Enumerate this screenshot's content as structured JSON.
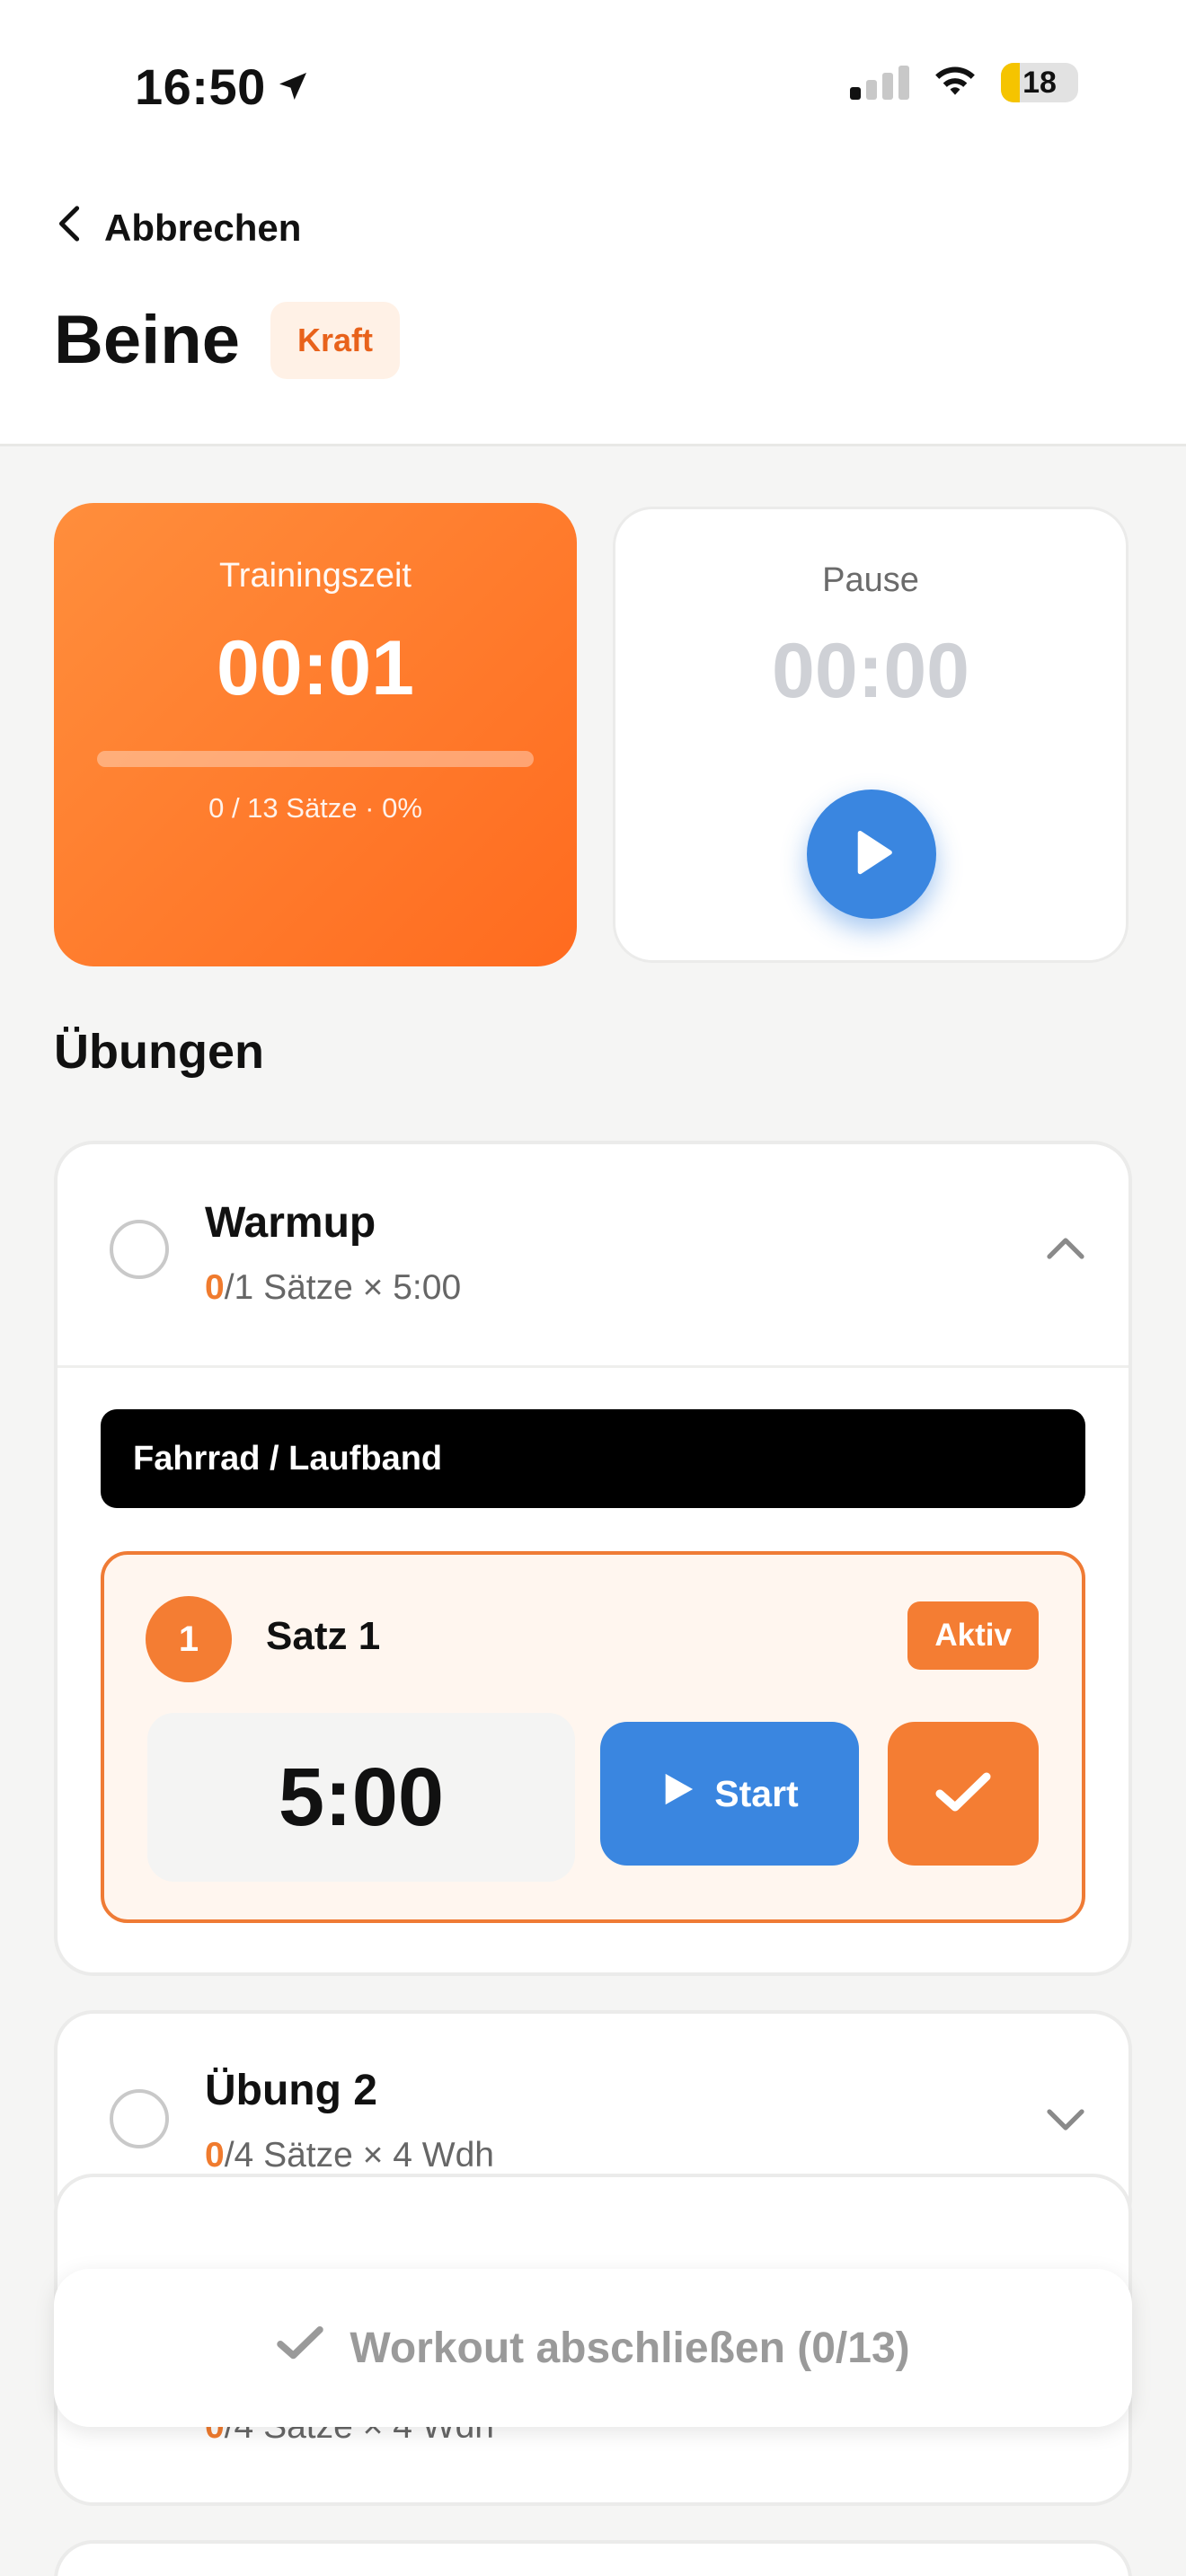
{
  "status_bar": {
    "time": "16:50",
    "battery_level": "18"
  },
  "header": {
    "back_label": "Abbrechen",
    "title": "Beine",
    "tag": "Kraft"
  },
  "training_card": {
    "label": "Trainingszeit",
    "time": "00:01",
    "progress_text": "0 / 13 Sätze · 0%",
    "progress": 0
  },
  "pause_card": {
    "label": "Pause",
    "time": "00:00"
  },
  "exercises_section": {
    "title": "Übungen",
    "items": [
      {
        "name": "Warmup",
        "done": "0",
        "rest": "/1 Sätze × 5:00",
        "expanded": true,
        "equipment": "Fahrrad / Laufband",
        "set": {
          "number": "1",
          "title": "Satz 1",
          "status": "Aktiv",
          "duration": "5:00",
          "start_label": "Start"
        }
      },
      {
        "name": "Übung 2",
        "done": "0",
        "rest": "/4 Sätze × 4 Wdh",
        "expanded": false
      },
      {
        "name": "",
        "done": "0",
        "rest": "/4 Sätze × 4 Wdh",
        "expanded": false
      }
    ]
  },
  "footer": {
    "finish_label": "Workout abschließen (0/13)"
  },
  "colors": {
    "accent_orange": "#f47d33",
    "accent_blue": "#3a86e0"
  }
}
